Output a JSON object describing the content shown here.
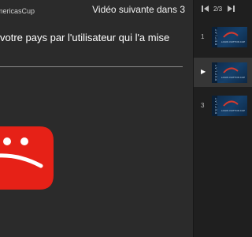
{
  "player": {
    "playlist_title": "de AmericasCup",
    "up_next": "Vidéo suivante dans 3",
    "message_line1": "votre pays par l'utilisateur qui l'a mise",
    "message_line2": ""
  },
  "sidebar": {
    "position": "2/3",
    "prev_icon": "skip-previous-icon",
    "next_icon": "skip-next-icon",
    "items": [
      {
        "index": "1",
        "thumb_strip": "REPLAY",
        "thumb_caption": "LOUIS VUITTON CUP",
        "active": false
      },
      {
        "index": "▶",
        "thumb_strip": "REPLAY",
        "thumb_caption": "LOUIS VUITTON CUP",
        "active": true
      },
      {
        "index": "3",
        "thumb_strip": "REPLAY",
        "thumb_caption": "LOUIS VUITTON CUP",
        "active": false
      }
    ]
  },
  "colors": {
    "error_red": "#e62117",
    "background": "#2b2b2b",
    "sidebar_bg": "#1f1f1f",
    "active_item": "#363636"
  }
}
